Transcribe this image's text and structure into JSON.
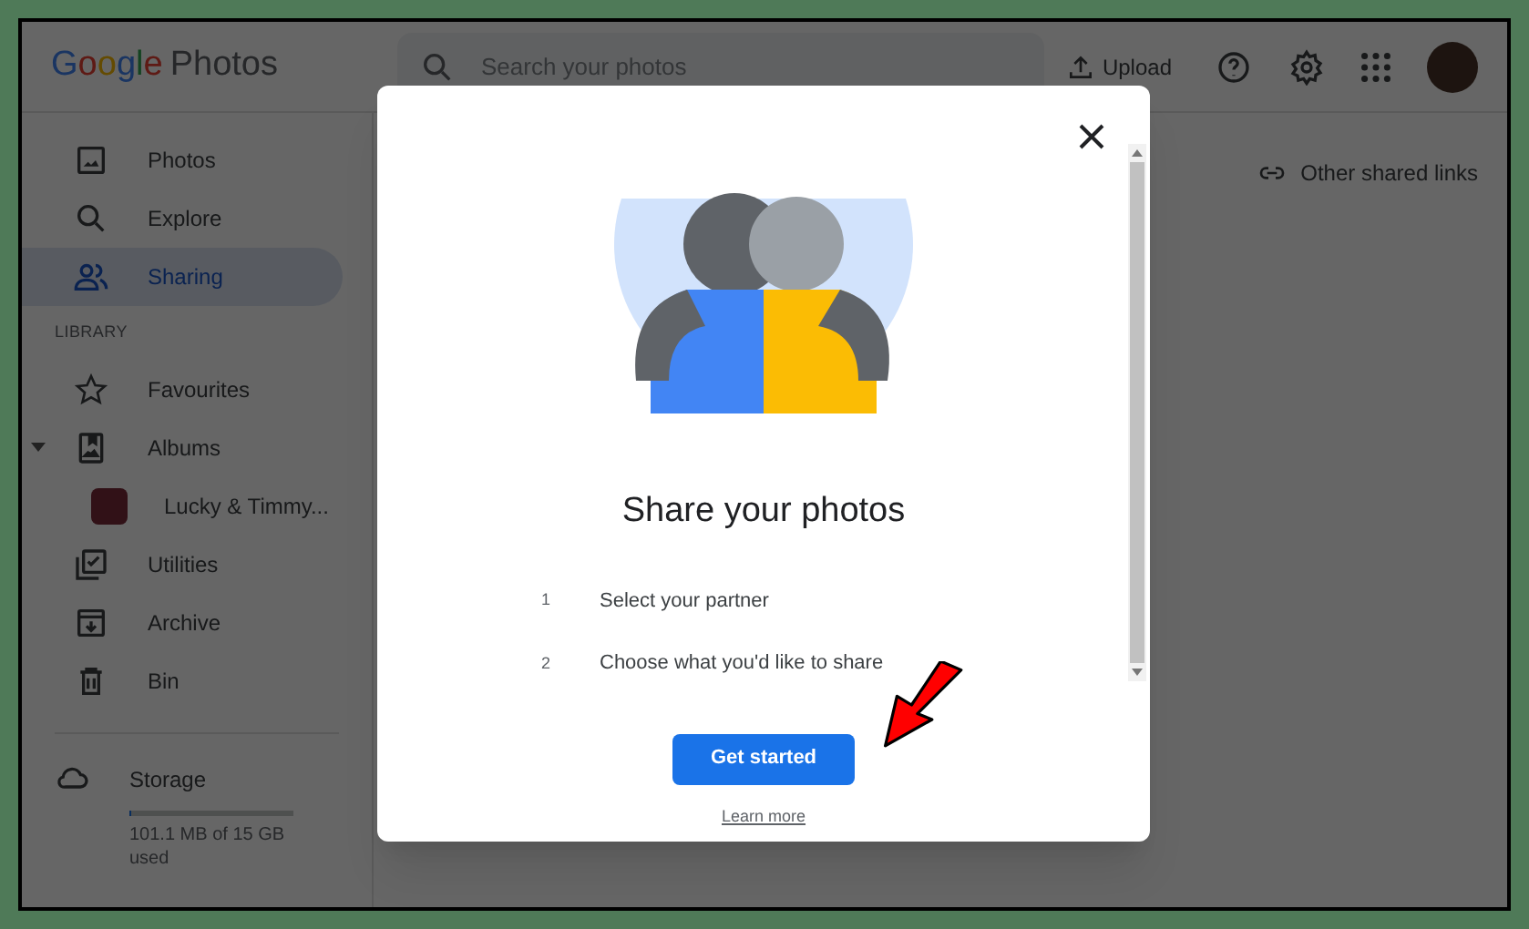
{
  "header": {
    "logo_brand": "Google",
    "logo_product": "Photos",
    "search": {
      "placeholder": "Search your photos"
    },
    "upload": "Upload"
  },
  "sidebar": {
    "items": [
      {
        "label": "Photos",
        "kind": "photo",
        "selected": false
      },
      {
        "label": "Explore",
        "kind": "search",
        "selected": false
      },
      {
        "label": "Sharing",
        "kind": "people",
        "selected": true
      }
    ],
    "section": "LIBRARY",
    "library": [
      {
        "label": "Favourites",
        "kind": "star",
        "selected": false
      },
      {
        "label": "Albums",
        "kind": "album",
        "selected": false,
        "expanded": true,
        "children": [
          {
            "label": "Lucky & Timmy...",
            "selected": false
          }
        ]
      },
      {
        "label": "Utilities",
        "kind": "utilities",
        "selected": false
      },
      {
        "label": "Archive",
        "kind": "archive",
        "selected": false
      },
      {
        "label": "Bin",
        "kind": "bin",
        "selected": false
      }
    ],
    "storage": {
      "label": "Storage",
      "level": 0.01,
      "usage": "101.1 MB of 15 GB used"
    }
  },
  "content": {
    "link": "Other shared links"
  },
  "dialog": {
    "title": "Share your photos",
    "steps": [
      {
        "number": "1",
        "text": "Select your partner"
      },
      {
        "number": "2",
        "text": "Choose what you'd like to share"
      }
    ],
    "button": "Get started",
    "link": "Learn more"
  }
}
